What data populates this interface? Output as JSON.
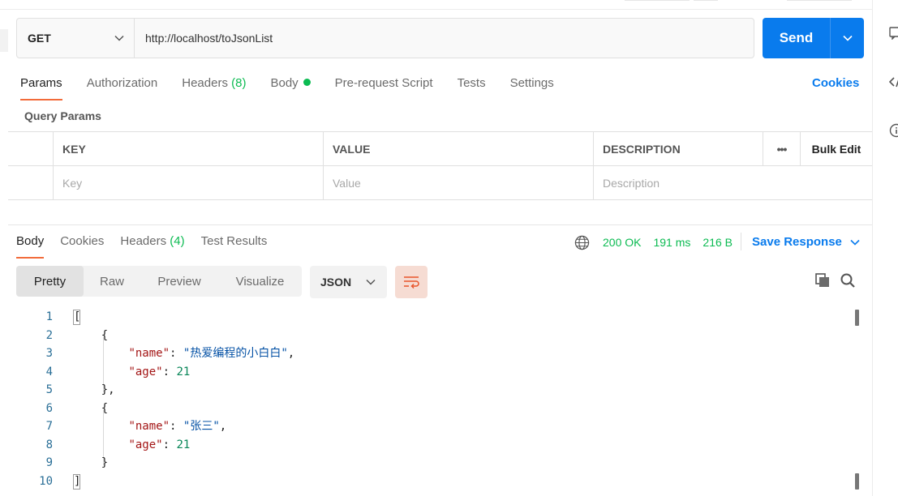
{
  "request": {
    "method": "GET",
    "url": "http://localhost/toJsonList",
    "send_label": "Send"
  },
  "request_tabs": [
    {
      "label": "Params",
      "active": true
    },
    {
      "label": "Authorization"
    },
    {
      "label": "Headers",
      "count": "(8)"
    },
    {
      "label": "Body",
      "indicator": true
    },
    {
      "label": "Pre-request Script"
    },
    {
      "label": "Tests"
    },
    {
      "label": "Settings"
    }
  ],
  "cookies_link": "Cookies",
  "query_params": {
    "title": "Query Params",
    "headers": {
      "key": "KEY",
      "value": "VALUE",
      "description": "DESCRIPTION",
      "more": "•••",
      "bulk_edit": "Bulk Edit"
    },
    "placeholders": {
      "key": "Key",
      "value": "Value",
      "description": "Description"
    }
  },
  "response_tabs": [
    {
      "label": "Body",
      "active": true
    },
    {
      "label": "Cookies"
    },
    {
      "label": "Headers",
      "count": "(4)"
    },
    {
      "label": "Test Results"
    }
  ],
  "response_status": {
    "status": "200 OK",
    "time": "191 ms",
    "size": "216 B",
    "save_label": "Save Response"
  },
  "view_modes": [
    "Pretty",
    "Raw",
    "Preview",
    "Visualize"
  ],
  "active_view": "Pretty",
  "format": "JSON",
  "code_lines": [
    {
      "n": "1",
      "text": "["
    },
    {
      "n": "2",
      "text": "    {"
    },
    {
      "n": "3",
      "key": "name",
      "str": "热爱编程的小白白",
      "trail": ","
    },
    {
      "n": "4",
      "key": "age",
      "num": "21"
    },
    {
      "n": "5",
      "text": "    },"
    },
    {
      "n": "6",
      "text": "    {"
    },
    {
      "n": "7",
      "key": "name",
      "str": "张三",
      "trail": ","
    },
    {
      "n": "8",
      "key": "age",
      "num": "21"
    },
    {
      "n": "9",
      "text": "    }"
    },
    {
      "n": "10",
      "text": "]"
    }
  ],
  "colors": {
    "accent": "#097bed",
    "tab_underline": "#f26b3a",
    "success": "#0cbb52"
  },
  "icons": {
    "method_dropdown": "chevron-down-icon",
    "send_dropdown": "chevron-down-icon",
    "globe": "globe-icon",
    "wrap": "wrap-lines-icon",
    "copy": "copy-icon",
    "search": "search-icon"
  }
}
